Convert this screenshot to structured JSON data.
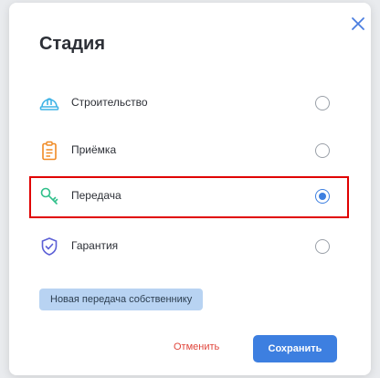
{
  "dialog": {
    "title": "Стадия",
    "close_icon": "close-icon"
  },
  "options": [
    {
      "label": "Строительство",
      "icon": "hard-hat-icon",
      "icon_color": "#3fb3e6",
      "checked": false
    },
    {
      "label": "Приёмка",
      "icon": "clipboard-icon",
      "icon_color": "#f08a24",
      "checked": false
    },
    {
      "label": "Передача",
      "icon": "key-icon",
      "icon_color": "#2fbf8a",
      "checked": true
    },
    {
      "label": "Гарантия",
      "icon": "shield-check-icon",
      "icon_color": "#5b5fd6",
      "checked": false
    }
  ],
  "chip": {
    "label": "Новая передача собственнику"
  },
  "actions": {
    "cancel_label": "Отменить",
    "save_label": "Сохранить"
  },
  "colors": {
    "accent": "#3d7fe0",
    "cancel": "#e0463c",
    "highlight_border": "#e00000",
    "chip_bg": "#b8d3f2"
  }
}
